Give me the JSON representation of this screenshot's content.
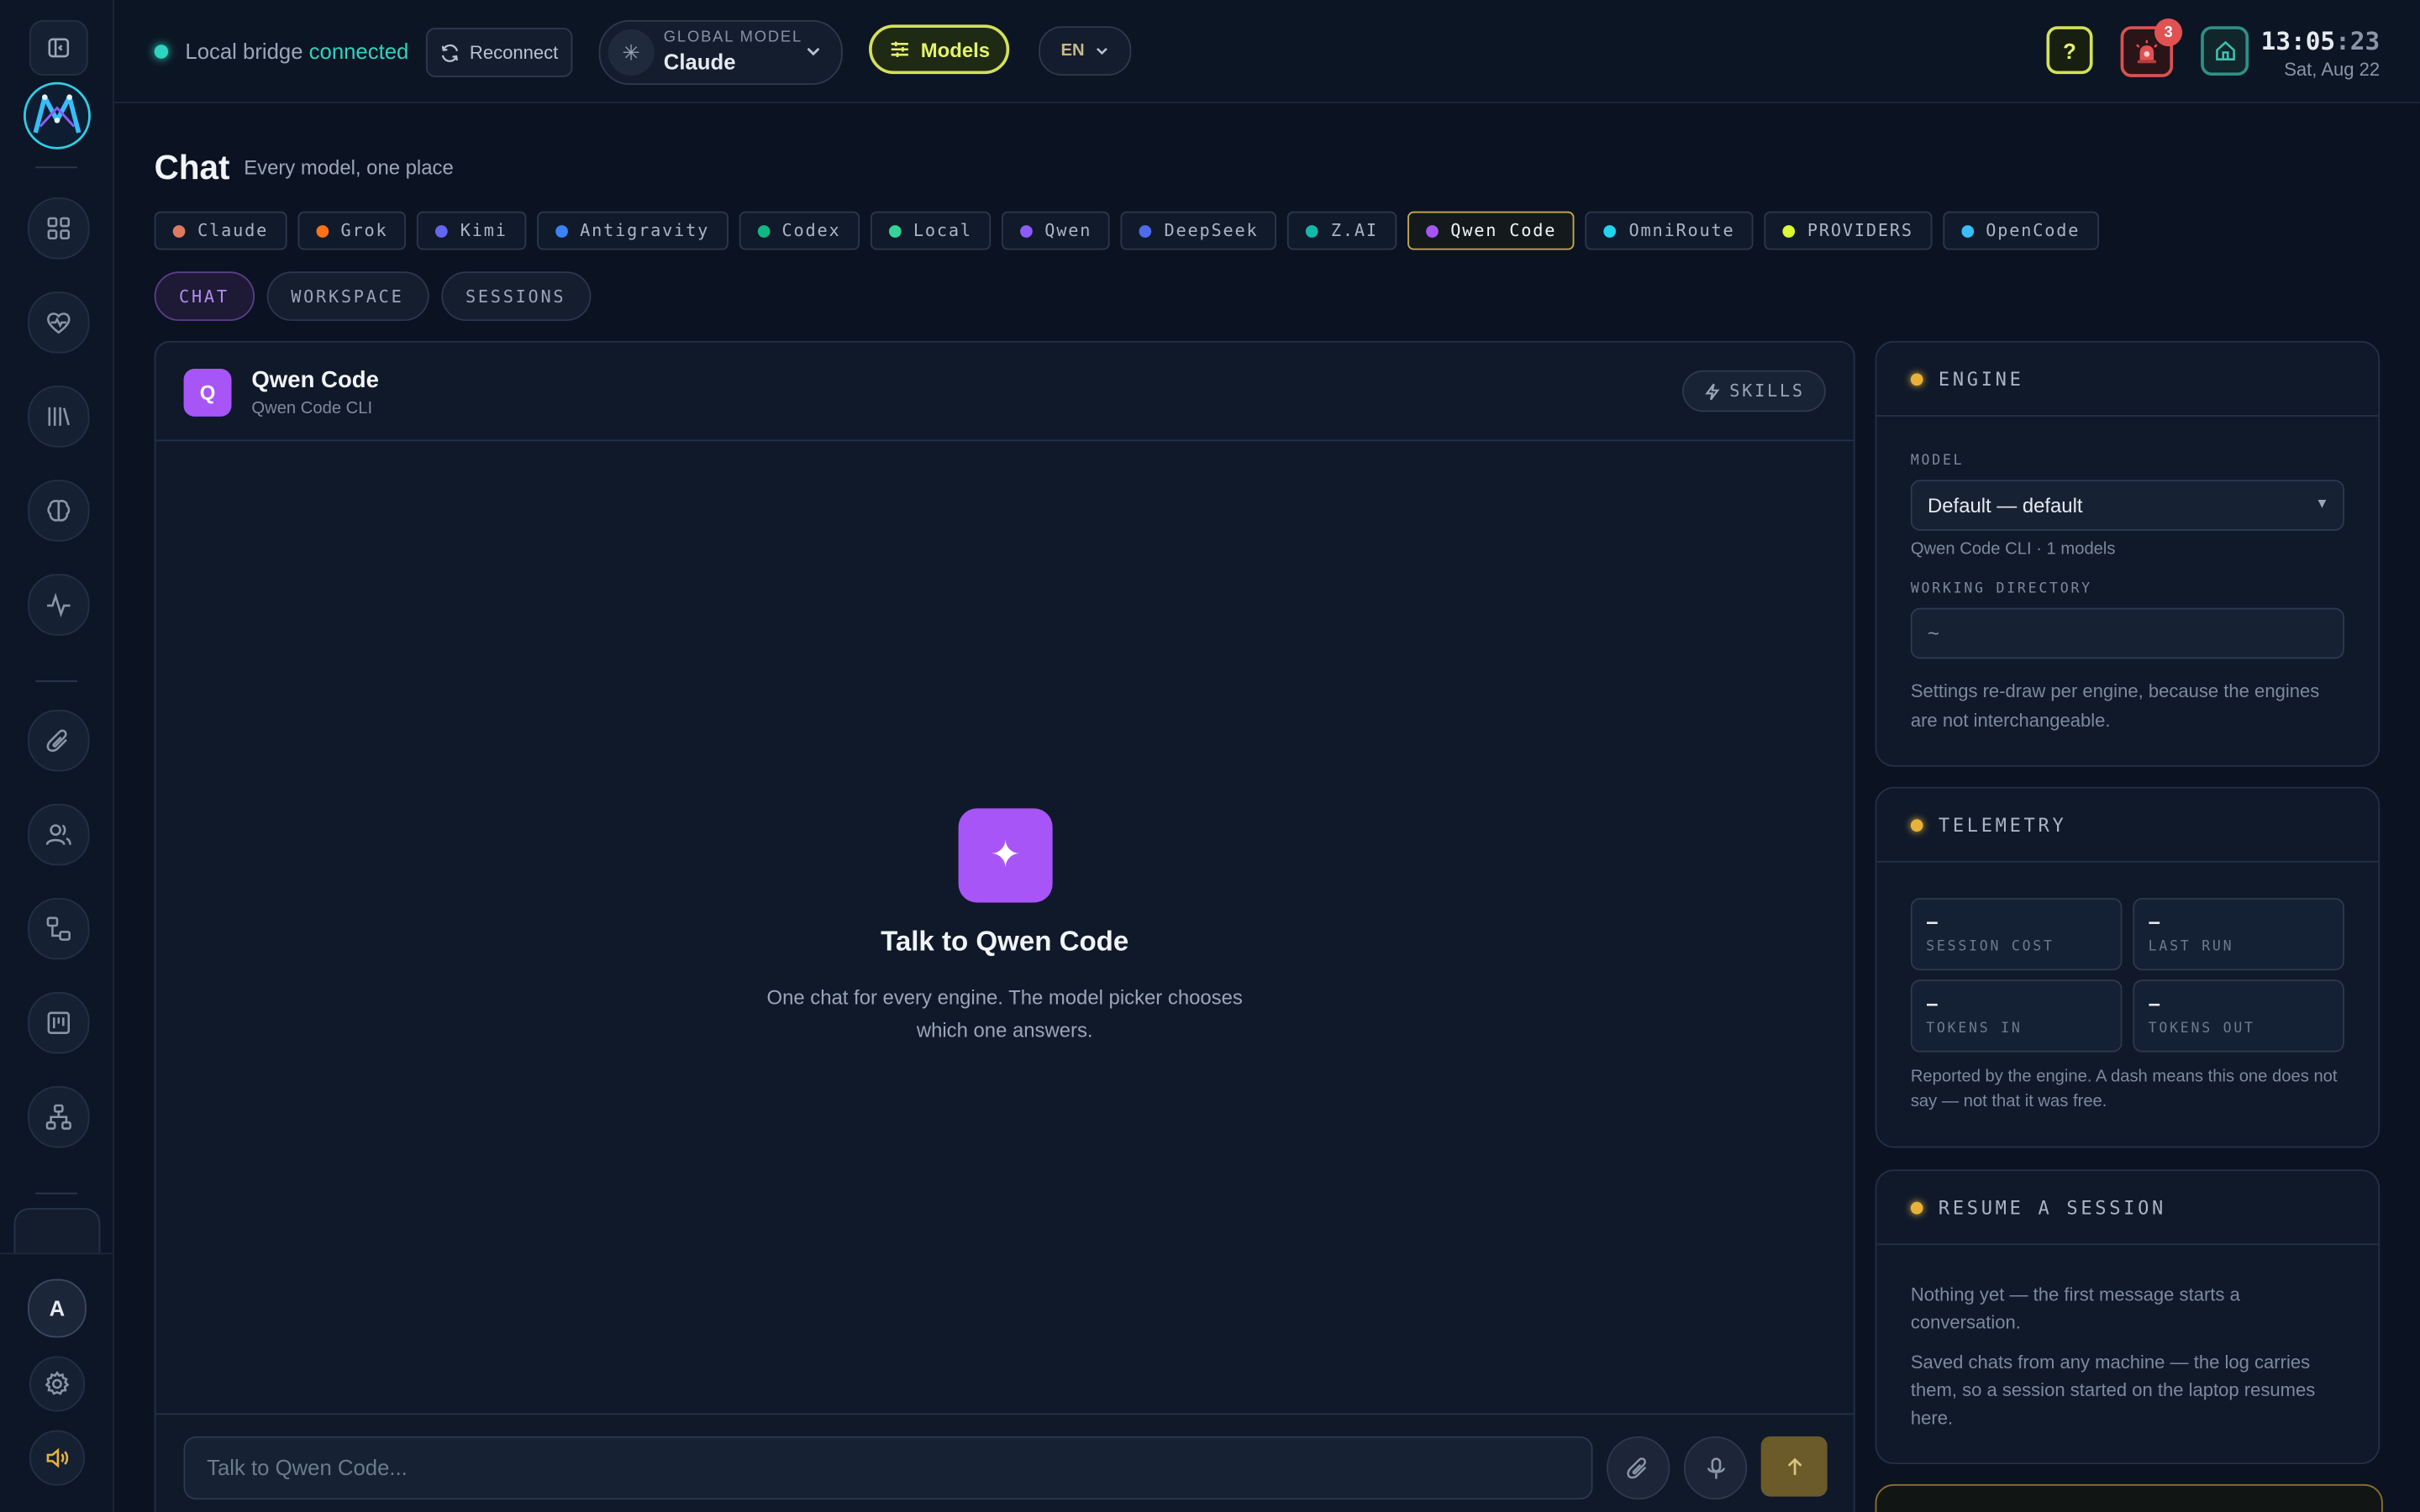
{
  "topbar": {
    "status_prefix": "Local bridge",
    "status_state": "connected",
    "reconnect_label": "Reconnect",
    "global_model_label": "GLOBAL MODEL",
    "global_model_value": "Claude",
    "models_label": "Models",
    "language": "EN",
    "help_label": "?",
    "alert_count": "3",
    "time_hm": "13:05",
    "time_sec": ":23",
    "date": "Sat, Aug 22"
  },
  "page": {
    "title": "Chat",
    "subtitle": "Every model, one place"
  },
  "engines": [
    {
      "label": "Claude",
      "color": "#e07a5f"
    },
    {
      "label": "Grok",
      "color": "#f97316"
    },
    {
      "label": "Kimi",
      "color": "#6366f1"
    },
    {
      "label": "Antigravity",
      "color": "#3b82f6"
    },
    {
      "label": "Codex",
      "color": "#10b981"
    },
    {
      "label": "Local",
      "color": "#34d399"
    },
    {
      "label": "Qwen",
      "color": "#8b5cf6"
    },
    {
      "label": "DeepSeek",
      "color": "#4f6bed"
    },
    {
      "label": "Z.AI",
      "color": "#14b8a6"
    },
    {
      "label": "Qwen Code",
      "color": "#a855f7",
      "active": true
    },
    {
      "label": "OmniRoute",
      "color": "#22d3ee"
    },
    {
      "label": "PROVIDERS",
      "color": "#d9f934"
    },
    {
      "label": "OpenCode",
      "color": "#38bdf8"
    }
  ],
  "tabs": [
    {
      "label": "CHAT",
      "active": true
    },
    {
      "label": "WORKSPACE"
    },
    {
      "label": "SESSIONS"
    }
  ],
  "chat": {
    "engine_initial": "Q",
    "engine_name": "Qwen Code",
    "engine_sub": "Qwen Code CLI",
    "skills_label": "SKILLS",
    "empty_title": "Talk to Qwen Code",
    "empty_text": "One chat for every engine. The model picker chooses which one answers.",
    "input_placeholder": "Talk to Qwen Code..."
  },
  "engine_card": {
    "title": "ENGINE",
    "model_label": "MODEL",
    "model_value": "Default — default",
    "model_hint": "Qwen Code CLI · 1 models",
    "dir_label": "WORKING DIRECTORY",
    "dir_value": "~",
    "note": "Settings re-draw per engine, because the engines are not interchangeable."
  },
  "telemetry_card": {
    "title": "TELEMETRY",
    "stats": [
      {
        "value": "–",
        "label": "SESSION COST"
      },
      {
        "value": "–",
        "label": "LAST RUN"
      },
      {
        "value": "–",
        "label": "TOKENS IN"
      },
      {
        "value": "–",
        "label": "TOKENS OUT"
      }
    ],
    "note": "Reported by the engine. A dash means this one does not say — not that it was free."
  },
  "resume_card": {
    "title": "RESUME A SESSION",
    "line1": "Nothing yet — the first message starts a conversation.",
    "line2": "Saved chats from any machine — the log carries them, so a session started on the laptop resumes here."
  },
  "sidebar": {
    "avatar_initial": "A"
  }
}
